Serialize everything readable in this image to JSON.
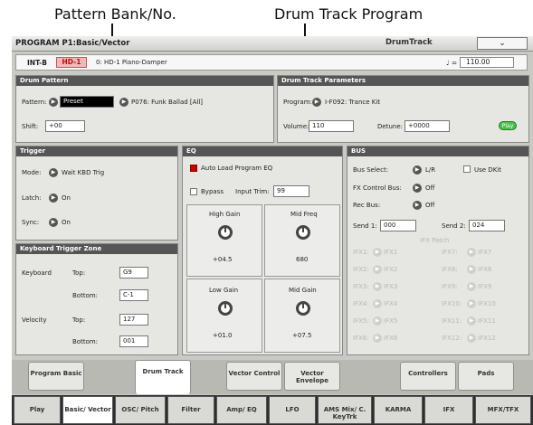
{
  "callouts": {
    "left": "Pattern Bank/No.",
    "right": "Drum Track Program"
  },
  "title": "PROGRAM P1:Basic/Vector",
  "page_tab": "DrumTrack",
  "dropdown_icon": "chevron-down-icon",
  "program": {
    "bank": "INT-B",
    "slot": "HD-1",
    "name": "0: HD-1 Piano-Damper",
    "tempo_symbol": "♩ =",
    "tempo": "110.00"
  },
  "drum_pattern": {
    "header": "Drum Pattern",
    "pattern_label": "Pattern:",
    "pattern_bank": "Preset",
    "pattern_name": "P076: Funk Ballad [All]",
    "shift_label": "Shift:",
    "shift": "+00"
  },
  "drum_track": {
    "header": "Drum Track Parameters",
    "program_label": "Program:",
    "program": "I-F092: Trance Kit",
    "volume_label": "Volume:",
    "volume": "110",
    "detune_label": "Detune:",
    "detune": "+0000",
    "play": "Play"
  },
  "trigger": {
    "header": "Trigger",
    "mode_label": "Mode:",
    "mode": "Wait KBD Trig",
    "latch_label": "Latch:",
    "latch": "On",
    "sync_label": "Sync:",
    "sync": "On"
  },
  "kbd_zone": {
    "header": "Keyboard Trigger Zone",
    "keyboard_label": "Keyboard",
    "top_label": "Top:",
    "bottom_label": "Bottom:",
    "kb_top": "G9",
    "kb_bottom": "C-1",
    "velocity_label": "Velocity",
    "vel_top": "127",
    "vel_bottom": "001"
  },
  "eq": {
    "header": "EQ",
    "auto_load": "Auto Load Program EQ",
    "bypass": "Bypass",
    "input_trim_label": "Input Trim:",
    "input_trim": "99",
    "high_gain_label": "High Gain",
    "high_gain": "+04.5",
    "mid_freq_label": "Mid Freq",
    "mid_freq": "680",
    "low_gain_label": "Low Gain",
    "low_gain": "+01.0",
    "mid_gain_label": "Mid Gain",
    "mid_gain": "+07.5"
  },
  "bus": {
    "header": "BUS",
    "bus_select_label": "Bus Select:",
    "bus_select": "L/R",
    "use_dkit": "Use DKit",
    "fx_control_label": "FX Control Bus:",
    "fx_control": "Off",
    "rec_bus_label": "Rec Bus:",
    "rec_bus": "Off",
    "send1_label": "Send 1:",
    "send1": "000",
    "send2_label": "Send 2:",
    "send2": "024",
    "ifx_patch_label": "IFX Patch",
    "ifx_left": [
      {
        "label": "IFX1:",
        "value": "IFX1"
      },
      {
        "label": "IFX2:",
        "value": "IFX2"
      },
      {
        "label": "IFX3:",
        "value": "IFX3"
      },
      {
        "label": "IFX4:",
        "value": "IFX4"
      },
      {
        "label": "IFX5:",
        "value": "IFX5"
      },
      {
        "label": "IFX6:",
        "value": "IFX6"
      }
    ],
    "ifx_right": [
      {
        "label": "IFX7:",
        "value": "IFX7"
      },
      {
        "label": "IFX8:",
        "value": "IFX8"
      },
      {
        "label": "IFX9:",
        "value": "IFX9"
      },
      {
        "label": "IFX10:",
        "value": "IFX10"
      },
      {
        "label": "IFX11:",
        "value": "IFX11"
      },
      {
        "label": "IFX12:",
        "value": "IFX12"
      }
    ]
  },
  "subtabs": [
    "Program Basic",
    "Drum Track",
    "Vector Control",
    "Vector Envelope",
    "Controllers",
    "Pads"
  ],
  "maintabs": [
    "Play",
    "Basic/ Vector",
    "OSC/ Pitch",
    "Filter",
    "Amp/ EQ",
    "LFO",
    "AMS Mix/ C. KeyTrk",
    "KARMA",
    "IFX",
    "MFX/TFX"
  ],
  "colors": {
    "header": "#555555",
    "active_tab": "#ffffff",
    "highlight_red": "#cc0000",
    "play_green": "#4bbf4b"
  }
}
